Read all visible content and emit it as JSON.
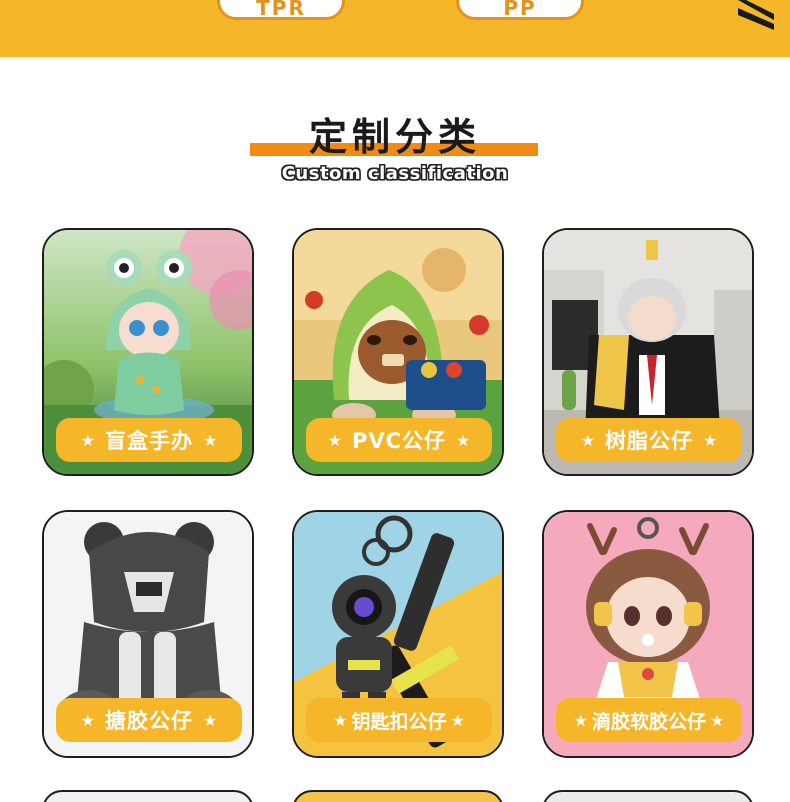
{
  "top_band": {
    "pills": [
      "TPR",
      "PP"
    ],
    "accent_color": "#f6b62a"
  },
  "section": {
    "title": "定制分类",
    "subtitle": "Custom classification"
  },
  "cards": [
    {
      "label": "盲盒手办",
      "image": "frog-hood-figure"
    },
    {
      "label": "PVC公仔",
      "image": "avocado-figure"
    },
    {
      "label": "树脂公仔",
      "image": "jacket-girl-figure"
    },
    {
      "label": "搪胶公仔",
      "image": "mecha-bear-figure"
    },
    {
      "label": "钥匙扣公仔",
      "image": "astronaut-keychain"
    },
    {
      "label": "滴胶软胶公仔",
      "image": "deer-girl-figure"
    }
  ],
  "star_glyph": "★"
}
